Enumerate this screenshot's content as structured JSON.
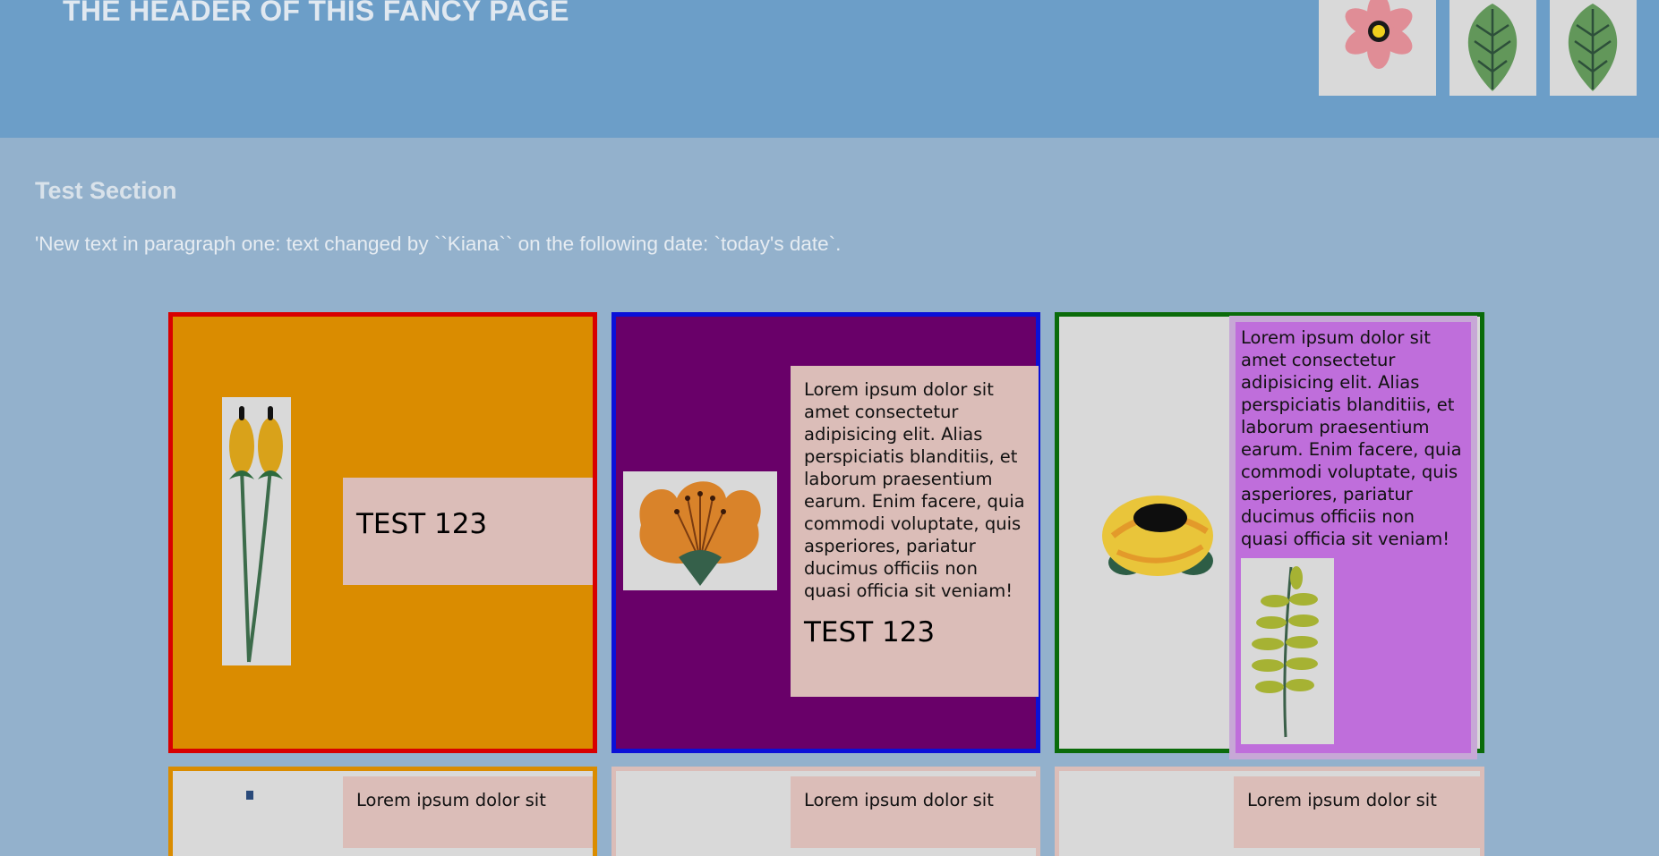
{
  "header": {
    "title": "THE HEADER OF THIS FANCY PAGE",
    "background": "#6c9ec8",
    "thumbnails": [
      "pink-flower-icon",
      "leaf-icon",
      "leaf-icon"
    ]
  },
  "section": {
    "title": "Test Section",
    "paragraph": "'New text in paragraph one: text changed by ``Kiana`` on the following date: `today's date`."
  },
  "cards": [
    {
      "border_color": "#d80000",
      "background": "#da8c00",
      "image_icon": "tulip-icon",
      "heading": "TEST 123"
    },
    {
      "border_color": "#0a10d8",
      "background": "#690069",
      "image_icon": "orange-flower-icon",
      "text": "Lorem ipsum dolor sit amet consectetur adipisicing elit. Alias perspiciatis blanditiis, et laborum praesentium earum. Enim facere, quia commodi voluptate, quis asperiores, pariatur ducimus officiis non quasi officia sit veniam!",
      "heading": "TEST 123"
    },
    {
      "border_color": "#0a6b0a",
      "background": "#d9d9d9",
      "image_icon": "yellow-rose-icon",
      "panel_color": "#bf6edb",
      "text": "Lorem ipsum dolor sit amet consectetur adipisicing elit. Alias perspiciatis blanditiis, et laborum praesentium earum. Enim facere, quia commodi voluptate, quis asperiores, pariatur ducimus officiis non quasi officia sit veniam!",
      "sub_image_icon": "fern-leaf-icon"
    }
  ],
  "second_row_partial_text": "Lorem ipsum dolor sit"
}
